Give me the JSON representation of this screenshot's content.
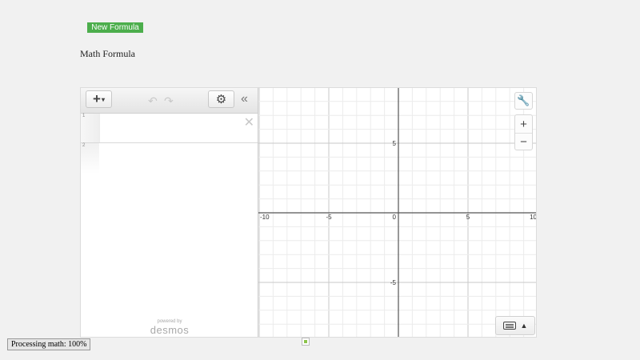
{
  "header": {
    "new_formula_label": "New Formula",
    "page_title": "Math Formula"
  },
  "expression_panel": {
    "rows": [
      {
        "index": "1",
        "delete_glyph": "✕"
      },
      {
        "index": "2"
      }
    ],
    "powered_by": "powered by",
    "brand": "desmos"
  },
  "graph": {
    "x_ticks": [
      "-10",
      "-5",
      "0",
      "5",
      "10"
    ],
    "y_ticks": [
      "5",
      "-5"
    ]
  },
  "status": {
    "text": "Processing math: 100%"
  },
  "icons": {
    "add": "plus-icon",
    "undo": "undo-icon",
    "redo": "redo-icon",
    "settings": "gear-icon",
    "collapse": "double-chevron-left-icon",
    "wrench": "wrench-icon",
    "zoom_in": "plus-icon",
    "zoom_out": "minus-icon",
    "keyboard": "keyboard-icon"
  },
  "colors": {
    "accent_green": "#4cae4c",
    "axis": "#555555",
    "major_grid": "#c8c8c8",
    "minor_grid": "#ececec"
  }
}
